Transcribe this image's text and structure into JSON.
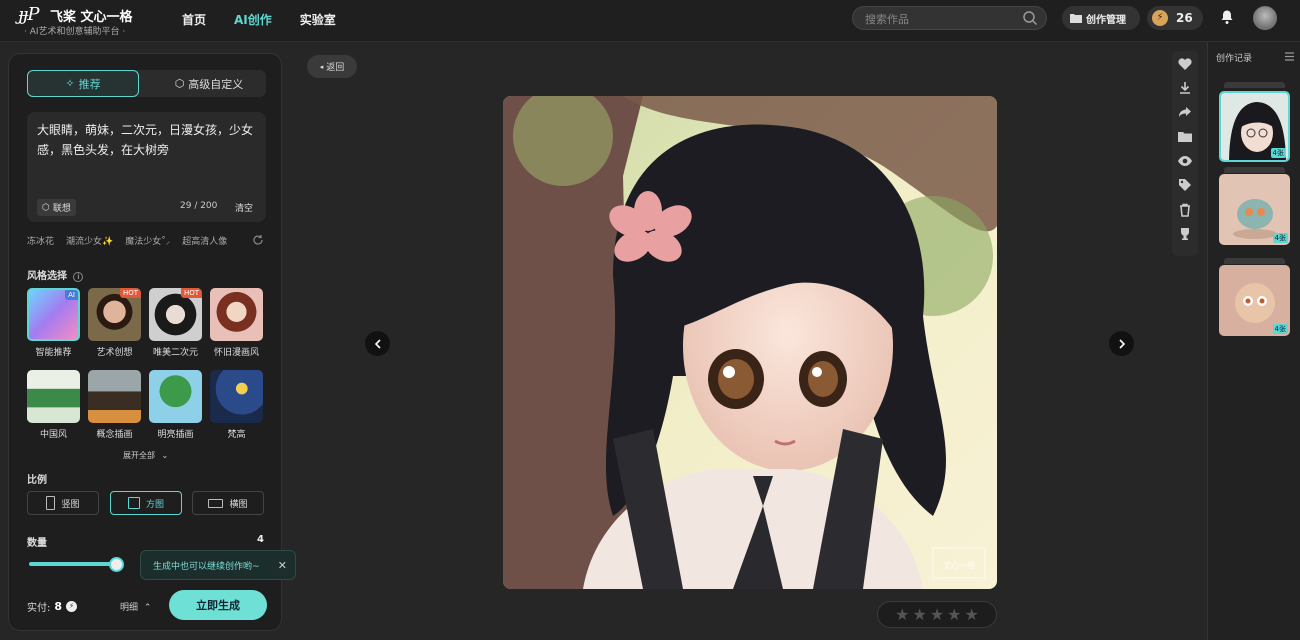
{
  "header": {
    "logo_mark": "ɟɟP",
    "logo_title": "飞桨 文心一格",
    "logo_subtitle": "· AI艺术和创意辅助平台 ·",
    "nav": [
      {
        "label": "首页",
        "active": false
      },
      {
        "label": "AI创作",
        "active": true
      },
      {
        "label": "实验室",
        "active": false
      }
    ],
    "search_placeholder": "搜索作品",
    "mgmt_label": "创作管理",
    "points": "26"
  },
  "panel": {
    "tabs": [
      "推荐",
      "高级自定义"
    ],
    "prompt_text": "大眼睛，萌妹，二次元，日漫女孩，少女感，黑色头发，在大树旁",
    "association_label": "联想",
    "char_count": "29 / 200",
    "clear_label": "清空",
    "suggest_tags": [
      "冻冰花",
      "潮流少女✨",
      "魔法少女˚⸝",
      "超高清人像"
    ],
    "style_title": "风格选择",
    "styles": [
      {
        "label": "智能推荐",
        "badge": "AI"
      },
      {
        "label": "艺术创想",
        "badge": "HOT"
      },
      {
        "label": "唯美二次元",
        "badge": "HOT"
      },
      {
        "label": "怀旧漫画风",
        "badge": ""
      },
      {
        "label": "中国风",
        "badge": ""
      },
      {
        "label": "概念插画",
        "badge": ""
      },
      {
        "label": "明亮插画",
        "badge": ""
      },
      {
        "label": "梵高",
        "badge": ""
      }
    ],
    "expand_label": "展开全部",
    "ratio_title": "比例",
    "ratios": [
      {
        "label": "竖图",
        "active": false
      },
      {
        "label": "方图",
        "active": true
      },
      {
        "label": "横图",
        "active": false
      }
    ],
    "quantity_title": "数量",
    "quantity_value": "4",
    "tooltip": "生成中也可以继续创作哟~",
    "pay_label": "实付:",
    "pay_value": "8",
    "detail_label": "明细",
    "generate_label": "立即生成"
  },
  "viewer": {
    "back_label": "返回",
    "watermark": "文心一格",
    "rating_max": 5
  },
  "history": {
    "title": "创作记录",
    "items": [
      {
        "count": "4张",
        "active": true
      },
      {
        "count": "4张",
        "active": false
      },
      {
        "count": "4张",
        "active": false
      }
    ]
  },
  "colors": {
    "accent": "#5ed6d2",
    "background": "#262626",
    "panel": "#1e1e1e"
  }
}
